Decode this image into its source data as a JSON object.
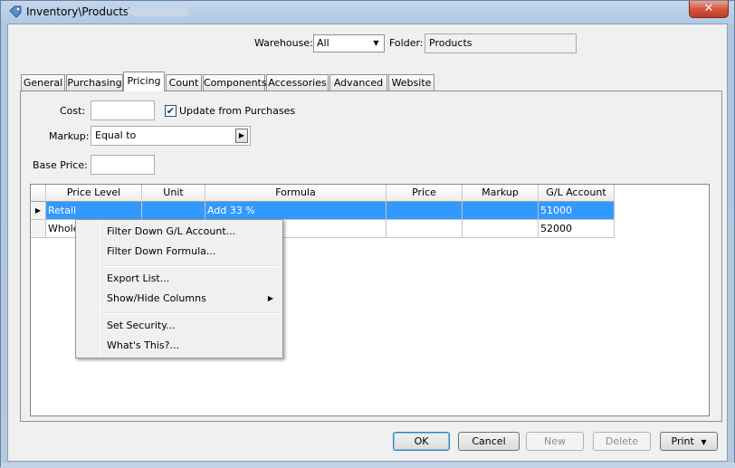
{
  "window": {
    "title": "Inventory\\Products\\",
    "close_label": "✕"
  },
  "header": {
    "warehouse_label": "Warehouse:",
    "warehouse_value": "All",
    "folder_label": "Folder:",
    "folder_value": "Products"
  },
  "tabs": [
    {
      "label": "General"
    },
    {
      "label": "Purchasing"
    },
    {
      "label": "Pricing"
    },
    {
      "label": "Count"
    },
    {
      "label": "Components"
    },
    {
      "label": "Accessories"
    },
    {
      "label": "Advanced"
    },
    {
      "label": "Website"
    }
  ],
  "active_tab": "Pricing",
  "pricing": {
    "cost_label": "Cost:",
    "cost_value": "",
    "update_label": "Update from Purchases",
    "update_checked": true,
    "markup_label": "Markup:",
    "markup_value": "Equal to",
    "base_price_label": "Base Price:",
    "base_price_value": ""
  },
  "grid": {
    "columns": [
      "Price Level",
      "Unit",
      "Formula",
      "Price",
      "Markup",
      "G/L Account"
    ],
    "rows": [
      {
        "price_level": "Retail",
        "unit": "",
        "formula": "Add 33  %",
        "price": "",
        "markup": "",
        "gl_account": "51000",
        "selected": true
      },
      {
        "price_level": "Whole",
        "unit": "",
        "formula": "",
        "price": "",
        "markup": "",
        "gl_account": "52000",
        "selected": false
      }
    ]
  },
  "context_menu": {
    "items": [
      {
        "label": "Filter Down G/L Account..."
      },
      {
        "label": "Filter Down Formula..."
      },
      {
        "label": "Export List..."
      },
      {
        "label": "Show/Hide Columns"
      },
      {
        "label": "Set Security..."
      },
      {
        "label": "What's This?..."
      }
    ]
  },
  "buttons": {
    "ok": "OK",
    "cancel": "Cancel",
    "new": "New",
    "delete": "Delete",
    "print": "Print"
  },
  "icons": {
    "title": "tag-icon",
    "dropdown": "chevron-down-icon",
    "submenu": "chevron-right-icon",
    "row_indicator": "triangle-right-icon"
  }
}
